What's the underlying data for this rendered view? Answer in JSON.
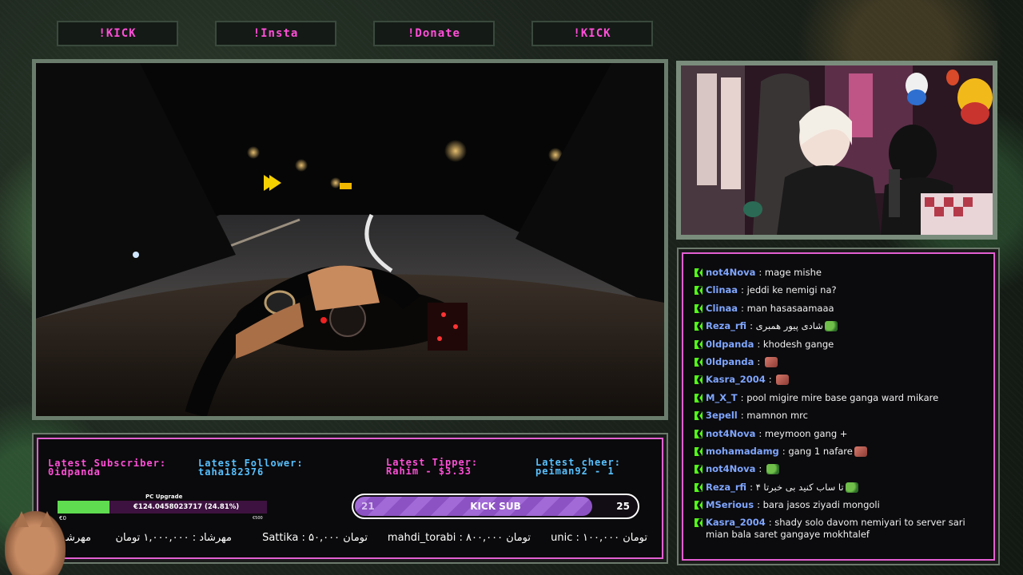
{
  "buttons": [
    {
      "label": "!KICK"
    },
    {
      "label": "!Insta"
    },
    {
      "label": "!Donate"
    },
    {
      "label": "!KICK"
    }
  ],
  "chat": [
    {
      "user": "not4Nova",
      "text": "mage mishe",
      "emote": ""
    },
    {
      "user": "Clinaa",
      "text": "jeddi ke nemigi na?",
      "emote": ""
    },
    {
      "user": "Clinaa",
      "text": "man hasasaamaaa",
      "emote": ""
    },
    {
      "user": "Reza_rfi",
      "text": "شادی پیور همبری",
      "emote": "frog"
    },
    {
      "user": "0ldpanda",
      "text": "khodesh gange",
      "emote": ""
    },
    {
      "user": "0ldpanda",
      "text": "",
      "emote": "clip"
    },
    {
      "user": "Kasra_2004",
      "text": "",
      "emote": "clip"
    },
    {
      "user": "M_X_T",
      "text": "pool migire mire base ganga ward mikare",
      "emote": ""
    },
    {
      "user": "3epell",
      "text": "mamnon mrc",
      "emote": ""
    },
    {
      "user": "not4Nova",
      "text": "meymoon gang +",
      "emote": ""
    },
    {
      "user": "mohamadamg",
      "text": "gang 1 nafare",
      "emote": "clip"
    },
    {
      "user": "not4Nova",
      "text": "",
      "emote": "frog"
    },
    {
      "user": "Reza_rfi",
      "text": "تا ساب کنید بی خبرتا ۴",
      "emote": "frog"
    },
    {
      "user": "MSerious",
      "text": "bara jasos ziyadi mongoli",
      "emote": ""
    },
    {
      "user": "Kasra_2004",
      "text": "shady solo davom nemiyari to server sari mian bala saret gangaye mokhtalef",
      "emote": ""
    }
  ],
  "info": {
    "latest_subscriber_label": "Latest Subscriber:",
    "latest_subscriber": "0idpanda",
    "latest_follower_label": "Latest Follower:",
    "latest_follower": "taha182376",
    "latest_tipper_label": "Latest Tipper:",
    "latest_tipper": "Rahim - $3.33",
    "latest_cheer_label": "Latest cheer:",
    "latest_cheer": "peiman92 - 1"
  },
  "goal": {
    "title": "PC Upgrade",
    "text": "€124.0458023717 (24.81%)",
    "progress": 0.2481,
    "min": "€0",
    "max": "€500"
  },
  "sub_goal": {
    "current": "21",
    "label": "KICK SUB",
    "target": "25",
    "progress": 0.84
  },
  "ticker": [
    "unic : ۱۰۰,۰۰۰ تومان",
    "mahdi_torabi : ۸۰۰,۰۰۰ تومان",
    "Sattika : ۵۰,۰۰۰ تومان",
    "مهرشاد : ۱,۰۰۰,۰۰۰ تومان",
    "مهرشا"
  ],
  "colors": {
    "accent_pink": "#ff4fd8",
    "accent_blue": "#57c1ff",
    "kick_green": "#53fc18",
    "chat_user": "#7fa6ff"
  }
}
